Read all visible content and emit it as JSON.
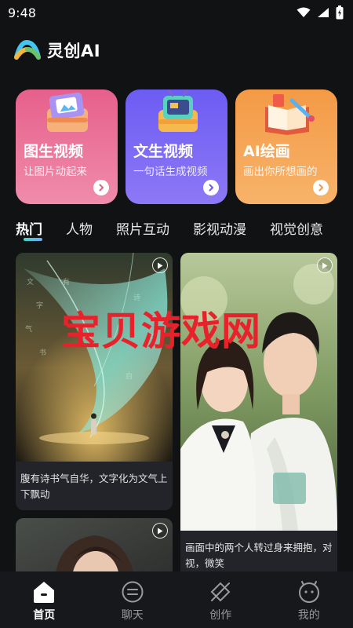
{
  "status_bar": {
    "time": "9:48"
  },
  "app": {
    "title": "灵创AI"
  },
  "features": [
    {
      "title": "图生视频",
      "subtitle": "让图片动起来",
      "color": "#e6608c"
    },
    {
      "title": "文生视频",
      "subtitle": "一句话生成视频",
      "color": "#6d5cf3"
    },
    {
      "title": "AI绘画",
      "subtitle": "画出你所想画的",
      "color": "#f49a45"
    }
  ],
  "tabs": [
    {
      "label": "热门",
      "active": true
    },
    {
      "label": "人物"
    },
    {
      "label": "照片互动"
    },
    {
      "label": "影视动漫"
    },
    {
      "label": "视觉创意"
    }
  ],
  "feed": [
    {
      "caption": "腹有诗书气自华，文字化为文气上下飘动"
    },
    {
      "caption": "画面中的两个人转过身来拥抱，对视，微笑"
    },
    {
      "caption": ""
    }
  ],
  "watermark": "宝贝游戏网",
  "bottom_nav": [
    {
      "label": "首页",
      "icon": "home-icon",
      "active": true
    },
    {
      "label": "聊天",
      "icon": "chat-icon"
    },
    {
      "label": "创作",
      "icon": "create-icon"
    },
    {
      "label": "我的",
      "icon": "profile-icon"
    }
  ]
}
